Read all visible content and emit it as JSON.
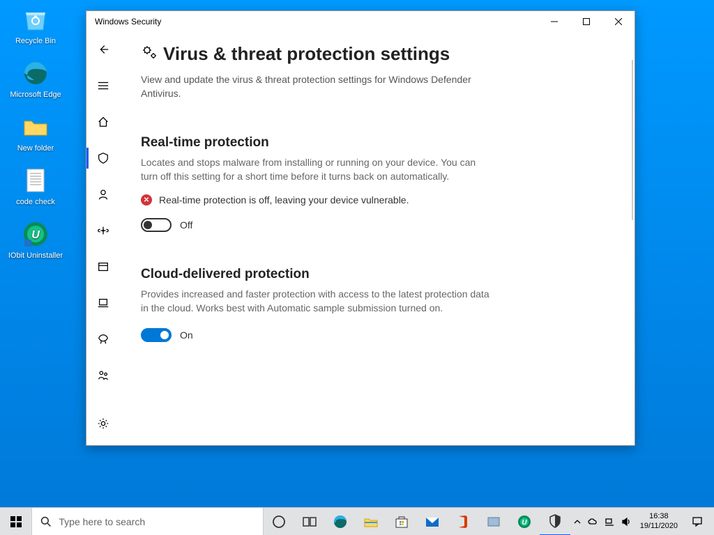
{
  "desktop_icons": {
    "recycle": "Recycle Bin",
    "edge": "Microsoft Edge",
    "folder": "New folder",
    "doc": "code check",
    "iobit": "IObit Uninstaller"
  },
  "window": {
    "title": "Windows Security",
    "page_title": "Virus & threat protection settings",
    "subtitle": "View and update the virus & threat protection settings for Windows Defender Antivirus."
  },
  "sections": {
    "rtp": {
      "title": "Real-time protection",
      "desc": "Locates and stops malware from installing or running on your device. You can turn off this setting for a short time before it turns back on automatically.",
      "warning": "Real-time protection is off, leaving your device vulnerable.",
      "toggle": "Off"
    },
    "cloud": {
      "title": "Cloud-delivered protection",
      "desc": "Provides increased and faster protection with access to the latest protection data in the cloud. Works best with Automatic sample submission turned on.",
      "toggle": "On"
    }
  },
  "search_placeholder": "Type here to search",
  "clock": {
    "time": "16:38",
    "date": "19/11/2020"
  }
}
